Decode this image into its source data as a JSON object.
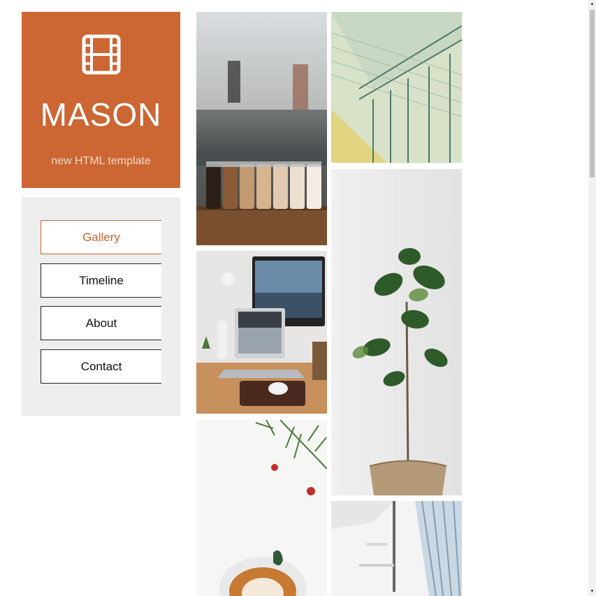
{
  "brand": {
    "icon": "film-icon",
    "title": "MASON",
    "subtitle": "new HTML template",
    "color": "#cc6633"
  },
  "nav": {
    "items": [
      {
        "label": "Gallery",
        "active": true
      },
      {
        "label": "Timeline",
        "active": false
      },
      {
        "label": "About",
        "active": false
      },
      {
        "label": "Contact",
        "active": false
      }
    ]
  },
  "gallery": {
    "images": [
      {
        "name": "coffee-jars-photo"
      },
      {
        "name": "desk-laptop-monitor-photo"
      },
      {
        "name": "latte-art-photo"
      },
      {
        "name": "banknote-building-engraving-photo"
      },
      {
        "name": "fiddle-leaf-fig-plant-photo"
      },
      {
        "name": "office-interior-photo"
      }
    ]
  }
}
